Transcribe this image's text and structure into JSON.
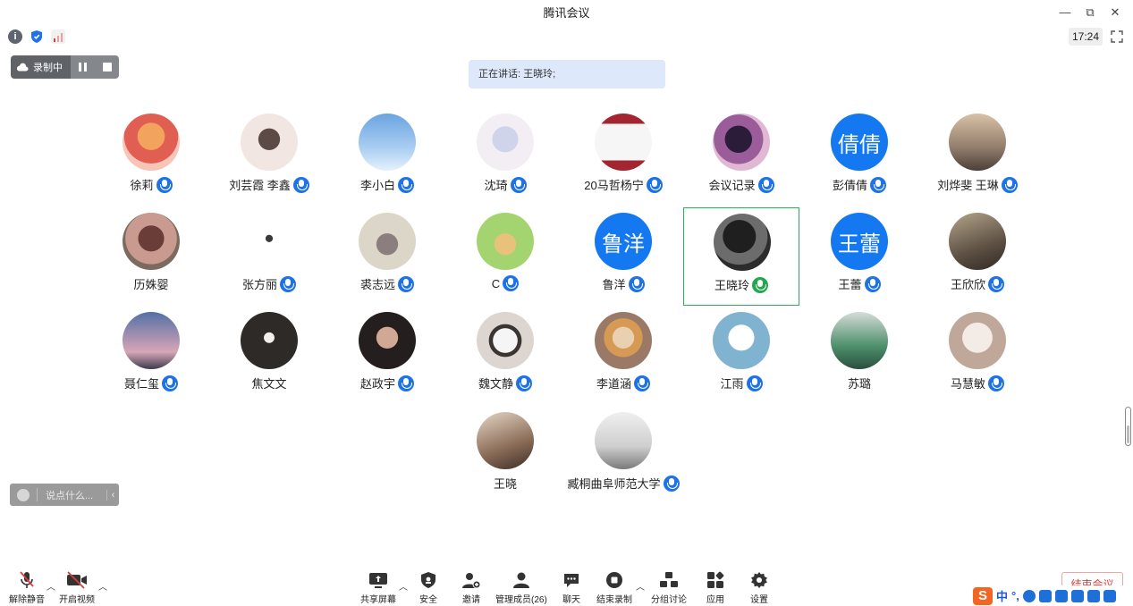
{
  "window": {
    "title": "腾讯会议",
    "minimize": "—",
    "restore": "⧉",
    "close": "✕"
  },
  "info_bar": {
    "info_glyph": "i",
    "clock": "17:24"
  },
  "recording": {
    "label": "录制中"
  },
  "speaking": {
    "text": "正在讲话: 王晓玲;"
  },
  "participants": [
    {
      "name": "徐莉",
      "avatar": "photo",
      "mic": true
    },
    {
      "name": "刘芸霞 李鑫",
      "avatar": "photo",
      "mic": true
    },
    {
      "name": "李小白",
      "avatar": "photo",
      "mic": true
    },
    {
      "name": "沈琦",
      "avatar": "photo",
      "mic": true
    },
    {
      "name": "20马哲杨宁",
      "avatar": "photo",
      "mic": true
    },
    {
      "name": "会议记录",
      "avatar": "photo",
      "mic": true
    },
    {
      "name": "彭倩倩",
      "avatar_text": "倩倩",
      "mic": true
    },
    {
      "name": "刘烨斐 王琳",
      "avatar": "photo",
      "mic": true
    },
    {
      "name": "历姝婴",
      "avatar": "photo",
      "mic": false
    },
    {
      "name": "张方丽",
      "avatar": "photo",
      "mic": true
    },
    {
      "name": "裘志远",
      "avatar": "photo",
      "mic": true
    },
    {
      "name": "C",
      "avatar": "photo",
      "mic": true
    },
    {
      "name": "鲁洋",
      "avatar_text": "鲁洋",
      "mic": true
    },
    {
      "name": "王晓玲",
      "avatar": "photo",
      "mic": true,
      "speaking": true
    },
    {
      "name": "王蕾",
      "avatar_text": "王蕾",
      "mic": true
    },
    {
      "name": "王欣欣",
      "avatar": "photo",
      "mic": true
    },
    {
      "name": "聂仁玺",
      "avatar": "photo",
      "mic": true
    },
    {
      "name": "焦文文",
      "avatar": "photo",
      "mic": false
    },
    {
      "name": "赵政宇",
      "avatar": "photo",
      "mic": true
    },
    {
      "name": "魏文静",
      "avatar": "photo",
      "mic": true
    },
    {
      "name": "李道涵",
      "avatar": "photo",
      "mic": true
    },
    {
      "name": "江雨",
      "avatar": "photo",
      "mic": true
    },
    {
      "name": "苏璐",
      "avatar": "photo",
      "mic": false
    },
    {
      "name": "马慧敏",
      "avatar": "photo",
      "mic": true
    },
    {
      "name": "王晓",
      "avatar": "photo",
      "mic": false
    },
    {
      "name": "臧桐曲阜师范大学",
      "avatar": "photo",
      "mic": true
    }
  ],
  "chat": {
    "placeholder": "说点什么...",
    "chevron": "‹"
  },
  "toolbar": {
    "unmute": "解除静音",
    "start_video": "开启视频",
    "share_screen": "共享屏幕",
    "security": "安全",
    "invite": "邀请",
    "manage_members": "管理成员(26)",
    "chat": "聊天",
    "end_recording": "结束录制",
    "breakout": "分组讨论",
    "apps": "应用",
    "settings": "设置",
    "end_meeting": "结束会议"
  },
  "ime": {
    "logo": "S",
    "mode": "中",
    "punct": "°,"
  },
  "colors": {
    "accent": "#1478f0",
    "speaking_border": "#2dae5a",
    "end_red": "#e03a3a"
  }
}
